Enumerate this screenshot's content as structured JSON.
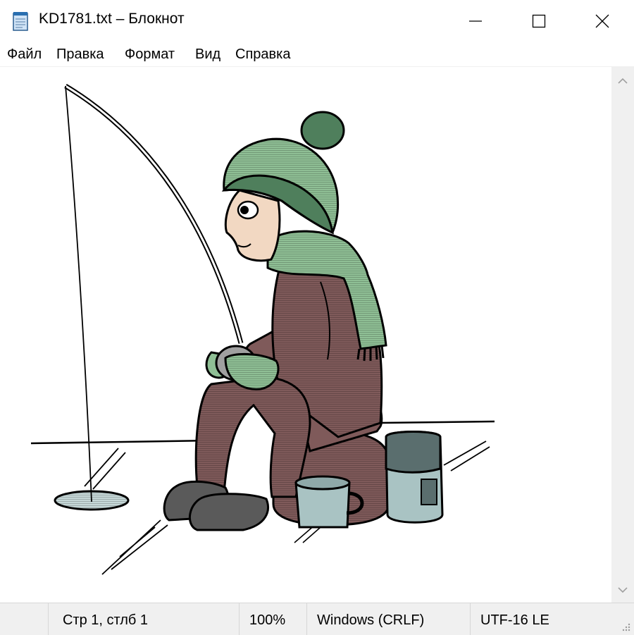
{
  "window": {
    "title": "KD1781.txt – Блокнот"
  },
  "menu": {
    "items": [
      {
        "label": "Файл"
      },
      {
        "label": "Правка"
      },
      {
        "label": "Формат"
      },
      {
        "label": "Вид"
      },
      {
        "label": "Справка"
      }
    ]
  },
  "status": {
    "position": "Стр 1, стлб 1",
    "zoom": "100%",
    "line_ending": "Windows (CRLF)",
    "encoding": "UTF-16 LE"
  },
  "colors": {
    "hat_green": "#8fbf95",
    "hat_dark": "#4f7f5c",
    "coat_brown": "#7f5a5a",
    "boots_gray": "#5a5a5a",
    "thermos_blue": "#a9c3c3",
    "skin": "#f2d8c2"
  },
  "icons": {
    "app": "notepad-icon",
    "minimize": "minimize-icon",
    "maximize": "maximize-icon",
    "close": "close-icon"
  }
}
